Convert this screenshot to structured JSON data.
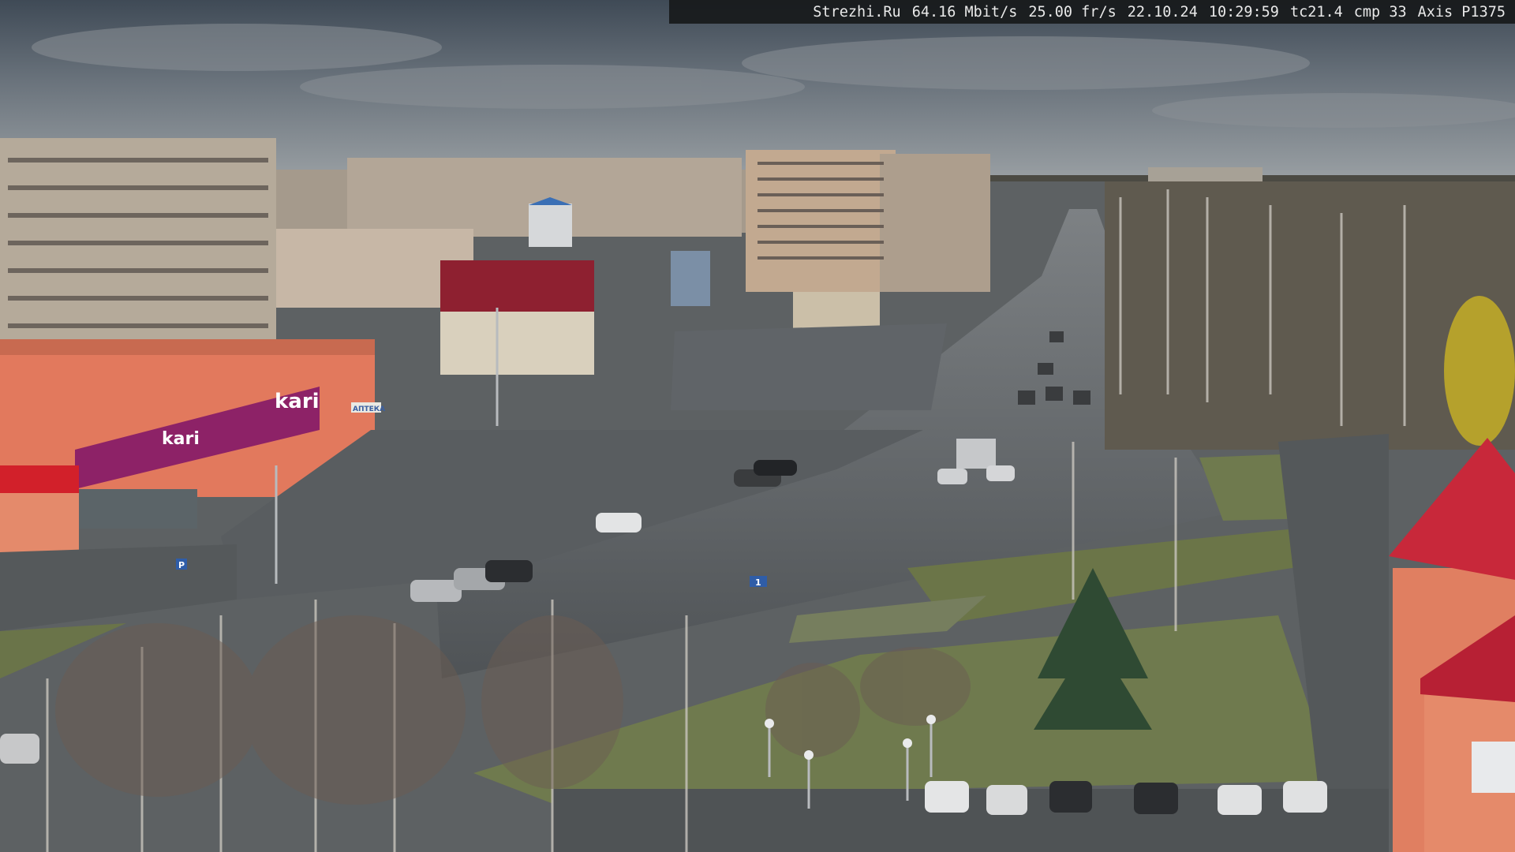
{
  "overlay": {
    "site": "Strezhi.Ru",
    "bitrate": "64.16 Mbit/s",
    "framerate": "25.00 fr/s",
    "date": "22.10.24",
    "time": "10:29:59",
    "tc": "tc21.4",
    "cmp": "cmp 33",
    "camera": "Axis P1375"
  },
  "signs": {
    "store_name": "kari",
    "store_slogan": "kari",
    "shop_sign": "АПТЕКА",
    "parking_sign": "P",
    "lane_sign": "1"
  },
  "colors": {
    "sky": "#5d6670",
    "store_facade": "#e2795d",
    "store_band": "#8d2267",
    "roof_red": "#c8283a",
    "grass": "#6f7a4e",
    "asphalt": "#55595c"
  }
}
